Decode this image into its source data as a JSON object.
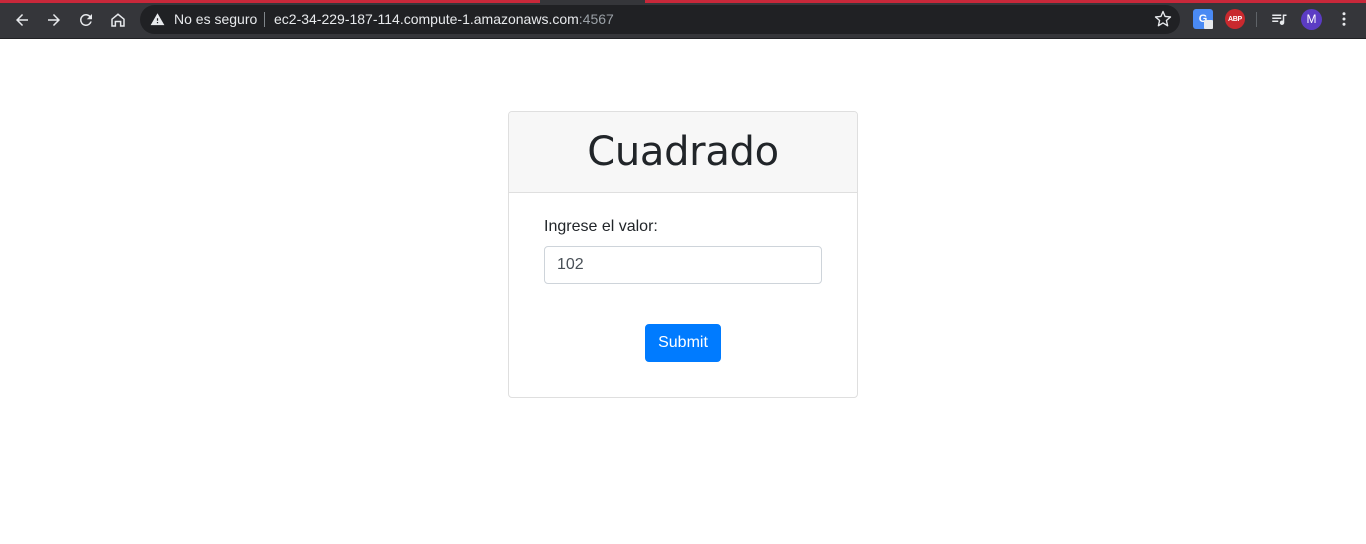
{
  "browser": {
    "security_label": "No es seguro",
    "url_host": "ec2-34-229-187-114.compute-1.amazonaws.com",
    "url_port": ":4567",
    "abp_label": "ABP",
    "avatar_letter": "M",
    "colors": {
      "toolbar": "#35363a",
      "omnibox": "#202124",
      "tab_accent": "#c8283a",
      "avatar": "#5b3cc4"
    }
  },
  "card": {
    "title": "Cuadrado",
    "label": "Ingrese el valor:",
    "input_value": "102",
    "submit_label": "Submit",
    "colors": {
      "button": "#007bff",
      "header_bg": "#f7f7f7"
    }
  }
}
